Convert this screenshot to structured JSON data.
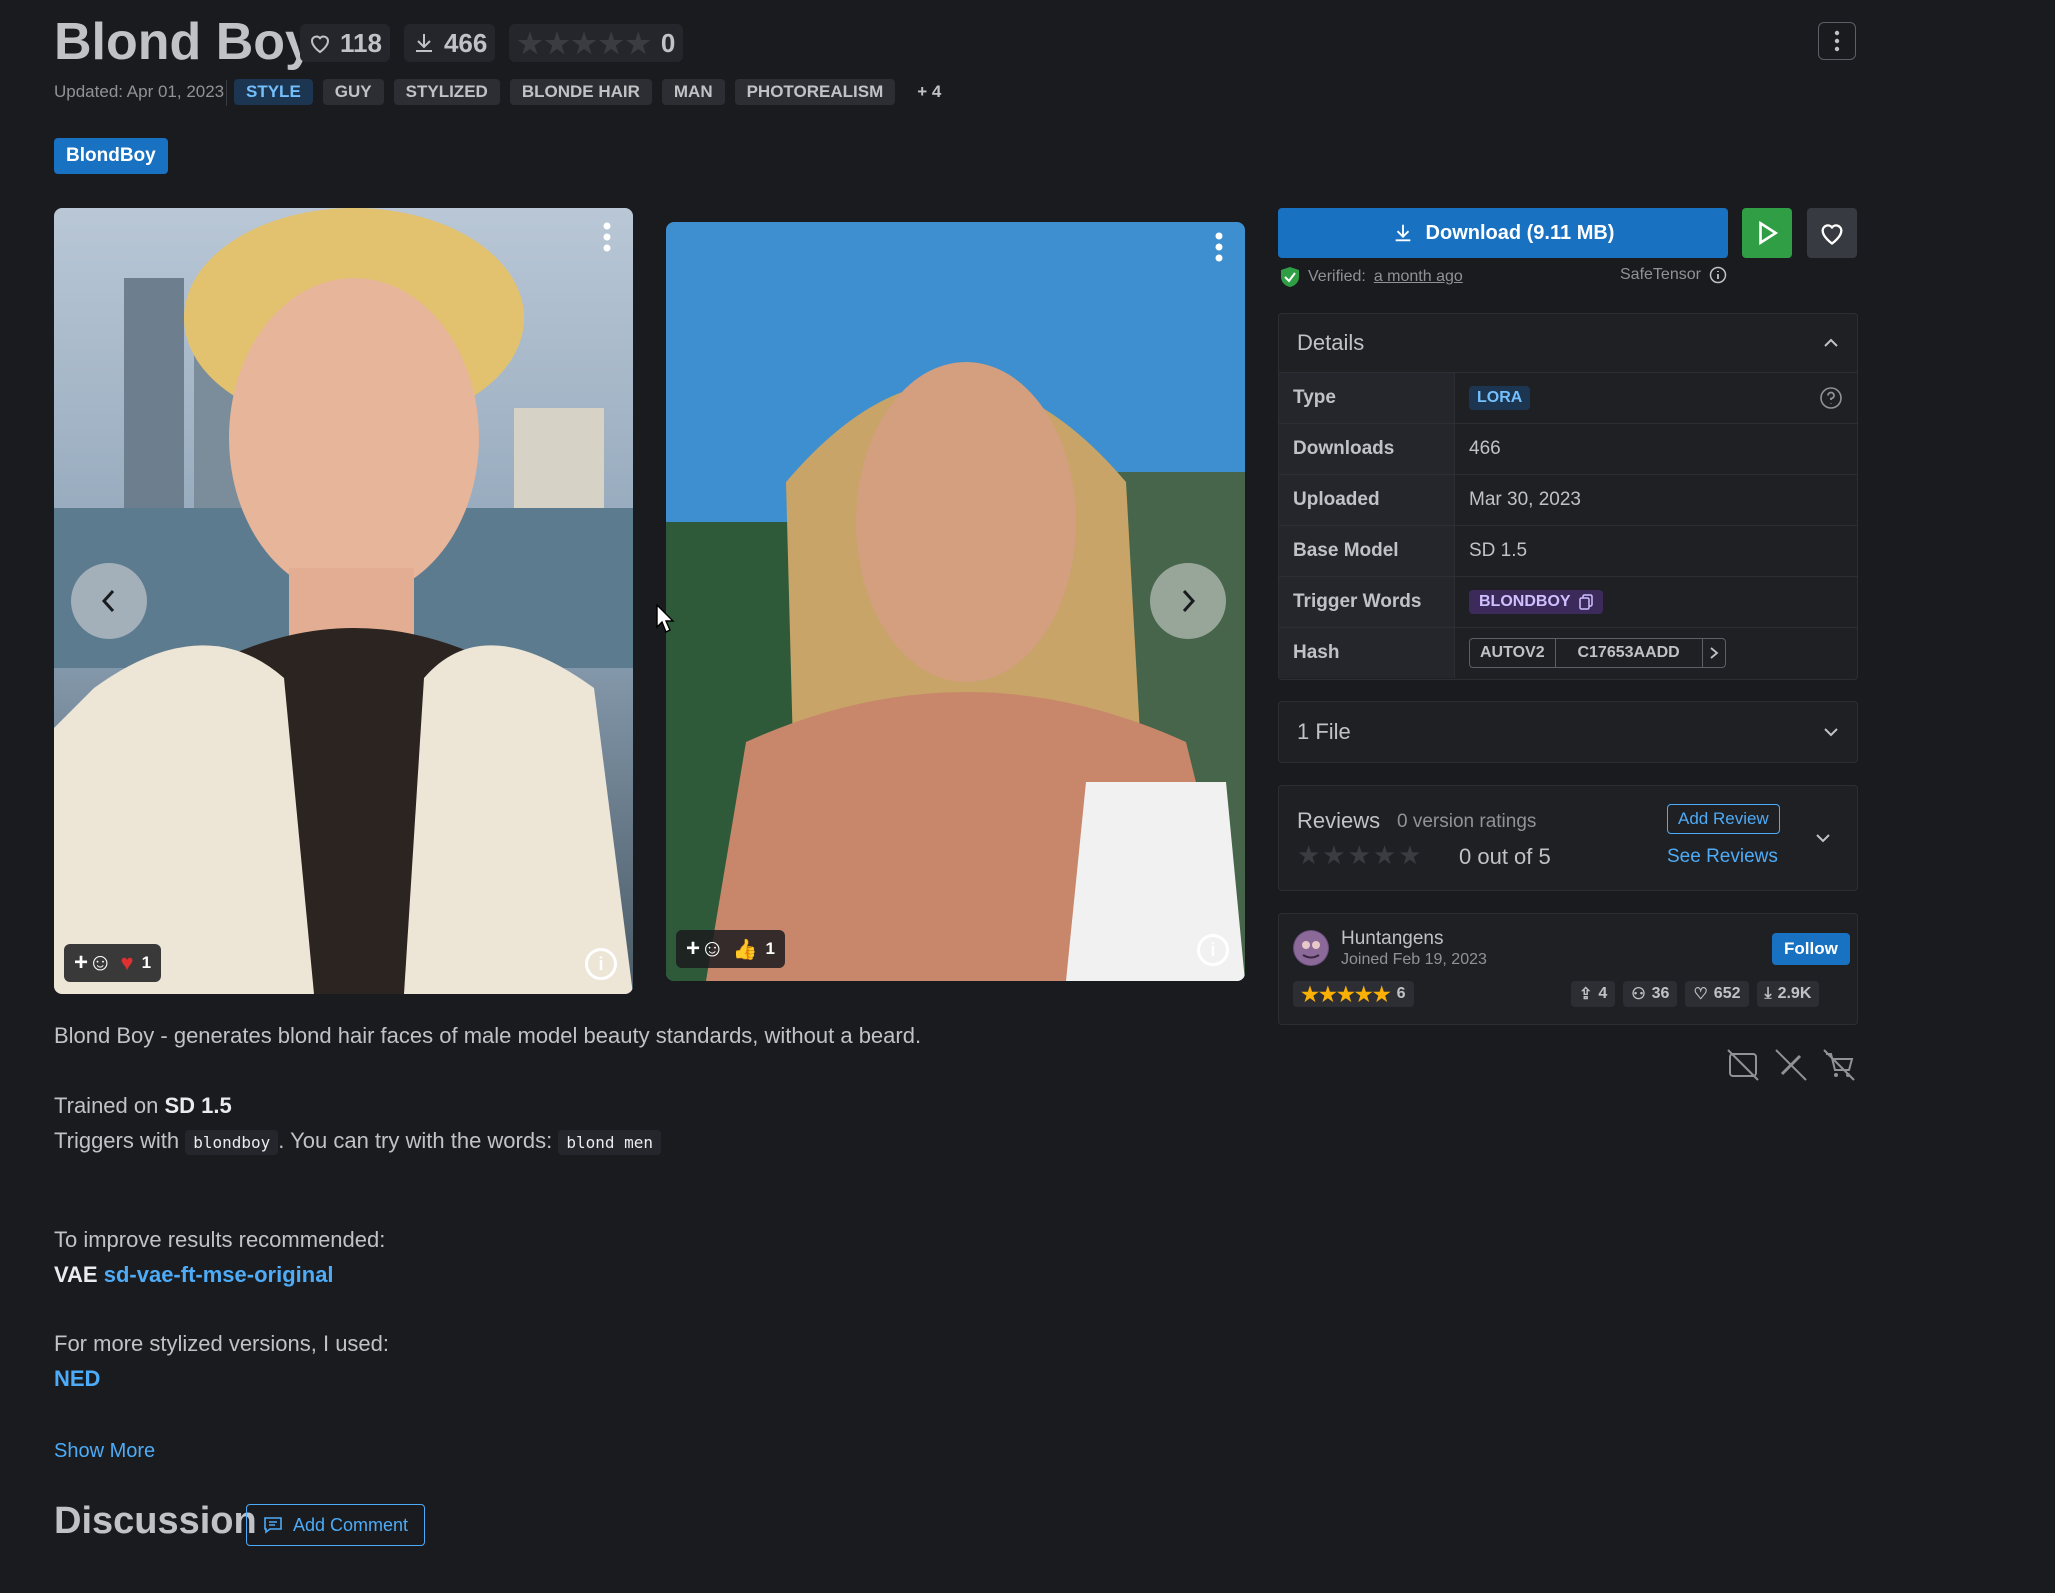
{
  "header": {
    "title": "Blond Boy",
    "likes": "118",
    "downloads": "466",
    "rating_count": "0",
    "updated": "Updated: Apr 01, 2023",
    "tags": [
      "STYLE",
      "GUY",
      "STYLIZED",
      "BLONDE HAIR",
      "MAN",
      "PHOTOREALISM"
    ],
    "more_tags": "+ 4",
    "trigger_badge": "BlondBoy"
  },
  "gallery": {
    "image1": {
      "reaction_count": "1"
    },
    "image2": {
      "reaction_count": "1"
    }
  },
  "sidebar": {
    "download_label": "Download (9.11 MB)",
    "verified_label": "Verified:",
    "verified_when": "a month ago",
    "safetensor": "SafeTensor",
    "details_title": "Details",
    "details": {
      "type_k": "Type",
      "type_v": "LORA",
      "downloads_k": "Downloads",
      "downloads_v": "466",
      "uploaded_k": "Uploaded",
      "uploaded_v": "Mar 30, 2023",
      "base_k": "Base Model",
      "base_v": "SD 1.5",
      "trigger_k": "Trigger Words",
      "trigger_v": "BLONDBOY",
      "hash_k": "Hash",
      "hash_type": "AUTOV2",
      "hash_v": "C17653AADD"
    },
    "files_label": "1 File",
    "reviews": {
      "title": "Reviews",
      "subtitle": "0 version ratings",
      "score": "0 out of 5",
      "add_review": "Add Review",
      "see_reviews": "See Reviews"
    },
    "creator": {
      "name": "Huntangens",
      "joined": "Joined Feb 19, 2023",
      "rating_count": "6",
      "follow_label": "Follow",
      "uploads": "4",
      "followers": "36",
      "likes": "652",
      "downloads": "2.9K"
    }
  },
  "description": {
    "line1": "Blond Boy - generates blond hair faces of male model beauty standards, without a beard.",
    "trained_prefix": "Trained on ",
    "trained_model": "SD 1.5",
    "triggers_prefix": "Triggers with ",
    "trigger_code": "blondboy",
    "triggers_middle": ". You can try with the words: ",
    "words_code": "blond men",
    "improve": "To improve results recommended:",
    "vae_prefix": "VAE ",
    "vae_link": "sd-vae-ft-mse-original",
    "stylized": "For more stylized versions, I used:",
    "ned_link": "NED",
    "show_more": "Show More"
  },
  "discussion": {
    "title": "Discussion",
    "add_comment": "Add Comment"
  },
  "colors": {
    "background": "#1a1b1e",
    "accent": "#1971c2",
    "play": "#2f9e44",
    "link": "#4dabf7"
  }
}
